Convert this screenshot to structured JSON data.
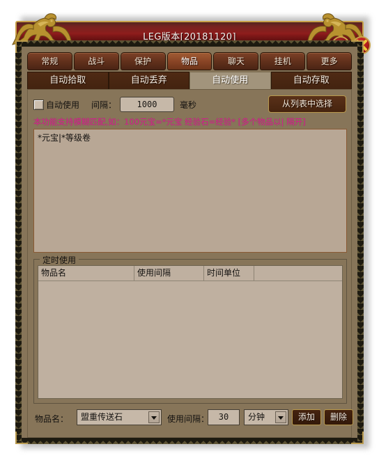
{
  "window": {
    "title": "LEG版本[20181120]",
    "minimize_label": "minimize",
    "close_label": "close",
    "accent_gold": "#c8a24a",
    "title_bg": "#8d1b1b",
    "panel_bg": "#877559"
  },
  "main_tabs": [
    {
      "label": "常规",
      "active": false
    },
    {
      "label": "战斗",
      "active": false
    },
    {
      "label": "保护",
      "active": false
    },
    {
      "label": "物品",
      "active": true
    },
    {
      "label": "聊天",
      "active": false
    },
    {
      "label": "挂机",
      "active": false
    },
    {
      "label": "更多",
      "active": false
    }
  ],
  "sub_tabs": [
    {
      "label": "自动拾取",
      "active": false
    },
    {
      "label": "自动丢弃",
      "active": false
    },
    {
      "label": "自动使用",
      "active": true
    },
    {
      "label": "自动存取",
      "active": false
    }
  ],
  "auto_use": {
    "checkbox_label": "自动使用",
    "checked": false,
    "interval_label": "间隔：",
    "interval_value": "1000",
    "interval_unit": "毫秒",
    "pick_from_list_button": "从列表中选择"
  },
  "hint": {
    "text": "本功能支持模糊匹配,如：100元宝=*元宝 经验石=经验* [多个物品以| 隔开]",
    "color": "#d4228e"
  },
  "item_list": {
    "value": "*元宝|*等级卷"
  },
  "timed_use": {
    "legend": "定时使用",
    "columns": [
      "物品名",
      "使用间隔",
      "时间单位",
      ""
    ],
    "rows": []
  },
  "bottom_controls": {
    "item_name_label": "物品名：",
    "item_name_value": "盟重传送石",
    "use_interval_label": "使用间隔：",
    "use_interval_value": "30",
    "time_unit_value": "分钟",
    "add_button": "添加",
    "delete_button": "删除"
  }
}
